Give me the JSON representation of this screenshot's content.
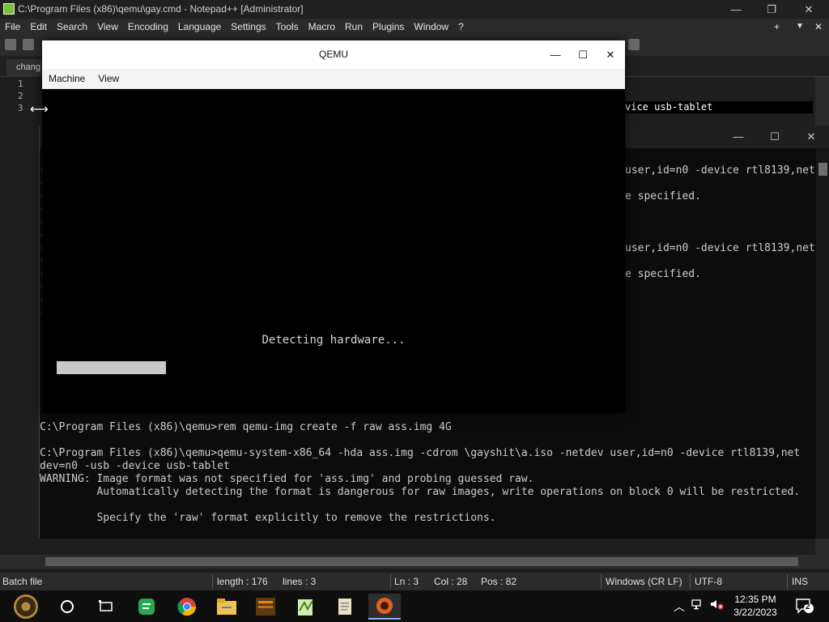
{
  "npp": {
    "title": "C:\\Program Files (x86)\\qemu\\gay.cmd - Notepad++ [Administrator]",
    "menu": [
      "File",
      "Edit",
      "Search",
      "View",
      "Encoding",
      "Language",
      "Settings",
      "Tools",
      "Macro",
      "Run",
      "Plugins",
      "Window",
      "?"
    ],
    "menu_right": {
      "add": "+",
      "dropdown": "▼",
      "close": "✕"
    },
    "tab_label": "chang",
    "line_numbers": [
      "1",
      "2",
      "3"
    ],
    "line3_visible": "vice usb-tablet",
    "status": {
      "lang": "Batch file",
      "length": "length : 176",
      "lines": "lines : 3",
      "ln": "Ln : 3",
      "col": "Col : 28",
      "pos": "Pos : 82",
      "eol": "Windows (CR LF)",
      "encoding": "UTF-8",
      "mode": "INS"
    }
  },
  "cmd": {
    "partial_lines": [
      {
        "left": "(",
        "right": "user,id=n0 -device rtl8139,net"
      },
      {
        "left": "(",
        "right": ""
      },
      {
        "left": "(",
        "right": "e specified."
      },
      {
        "left": "(",
        "right": ""
      },
      {
        "left": "(",
        "right": ""
      },
      {
        "left": "(",
        "right": ""
      },
      {
        "left": "(",
        "right": "user,id=n0 -device rtl8139,net"
      },
      {
        "left": "(",
        "right": ""
      },
      {
        "left": "(",
        "right": "e specified."
      },
      {
        "left": "(",
        "right": ""
      },
      {
        "left": "(",
        "right": ""
      },
      {
        "left": "(",
        "right": ""
      }
    ],
    "lines": [
      "C:\\Program Files (x86)\\qemu>rem qemu-img create -f raw ass.img 4G",
      "",
      "C:\\Program Files (x86)\\qemu>qemu-system-x86_64 -hda ass.img -cdrom \\gayshit\\a.iso -netdev user,id=n0 -device rtl8139,net",
      "dev=n0 -usb -device usb-tablet",
      "WARNING: Image format was not specified for 'ass.img' and probing guessed raw.",
      "         Automatically detecting the format is dangerous for raw images, write operations on block 0 will be restricted.",
      "",
      "         Specify the 'raw' format explicitly to remove the restrictions."
    ]
  },
  "qemu": {
    "title": "QEMU",
    "menu": [
      "Machine",
      "View"
    ],
    "caption": {
      "minimize": "—",
      "maximize": "☐",
      "close": "✕"
    },
    "screen_message": "Detecting hardware...",
    "progress": 0.35
  },
  "taskbar": {
    "time": "12:35 PM",
    "date": "3/22/2023",
    "notifications": "2"
  }
}
